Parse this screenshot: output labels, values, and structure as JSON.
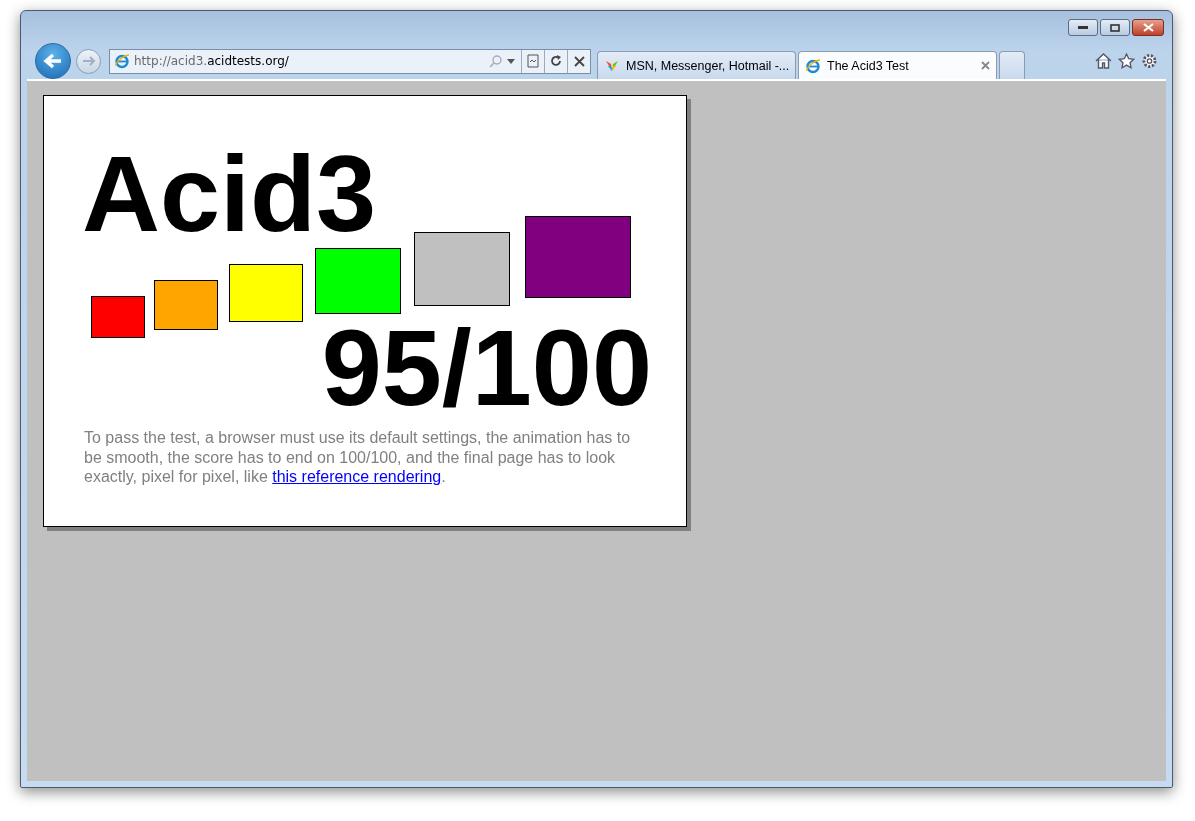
{
  "address": {
    "prefix": "http://acid3.",
    "domain": "acidtests.org/"
  },
  "tabs": [
    {
      "label": "MSN, Messenger, Hotmail -...",
      "selected": false,
      "kind": "butterfly"
    },
    {
      "label": "The Acid3 Test",
      "selected": true,
      "kind": "ie"
    }
  ],
  "page": {
    "title": "Acid3",
    "score": "95/100",
    "boxes": [
      {
        "color": "#ff0000"
      },
      {
        "color": "#ffa500"
      },
      {
        "color": "#ffff00"
      },
      {
        "color": "#00ff00"
      },
      {
        "color": "#c0c0c0"
      },
      {
        "color": "#800080"
      }
    ],
    "description": {
      "text": "To pass the test, a browser must use its default settings, the animation has to be smooth, the score has to end on 100/100, and the final page has to look exactly, pixel for pixel, like ",
      "link": "this reference rendering",
      "after": "."
    }
  }
}
